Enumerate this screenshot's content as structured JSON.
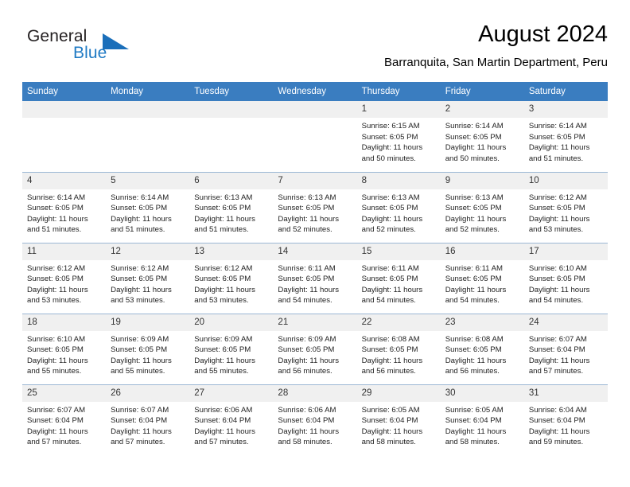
{
  "brand": {
    "name_primary": "General",
    "name_secondary": "Blue"
  },
  "header": {
    "title": "August 2024",
    "location": "Barranquita, San Martin Department, Peru"
  },
  "calendar": {
    "weekday_headers": [
      "Sunday",
      "Monday",
      "Tuesday",
      "Wednesday",
      "Thursday",
      "Friday",
      "Saturday"
    ],
    "colors": {
      "header_bg": "#3a7dc0",
      "daynum_bg": "#f0f0f0",
      "row_border": "#9bb7d4",
      "brand_blue": "#1f7ac4"
    },
    "weeks": [
      [
        {
          "day": "",
          "lines": []
        },
        {
          "day": "",
          "lines": []
        },
        {
          "day": "",
          "lines": []
        },
        {
          "day": "",
          "lines": []
        },
        {
          "day": "1",
          "lines": [
            "Sunrise: 6:15 AM",
            "Sunset: 6:05 PM",
            "Daylight: 11 hours",
            "and 50 minutes."
          ]
        },
        {
          "day": "2",
          "lines": [
            "Sunrise: 6:14 AM",
            "Sunset: 6:05 PM",
            "Daylight: 11 hours",
            "and 50 minutes."
          ]
        },
        {
          "day": "3",
          "lines": [
            "Sunrise: 6:14 AM",
            "Sunset: 6:05 PM",
            "Daylight: 11 hours",
            "and 51 minutes."
          ]
        }
      ],
      [
        {
          "day": "4",
          "lines": [
            "Sunrise: 6:14 AM",
            "Sunset: 6:05 PM",
            "Daylight: 11 hours",
            "and 51 minutes."
          ]
        },
        {
          "day": "5",
          "lines": [
            "Sunrise: 6:14 AM",
            "Sunset: 6:05 PM",
            "Daylight: 11 hours",
            "and 51 minutes."
          ]
        },
        {
          "day": "6",
          "lines": [
            "Sunrise: 6:13 AM",
            "Sunset: 6:05 PM",
            "Daylight: 11 hours",
            "and 51 minutes."
          ]
        },
        {
          "day": "7",
          "lines": [
            "Sunrise: 6:13 AM",
            "Sunset: 6:05 PM",
            "Daylight: 11 hours",
            "and 52 minutes."
          ]
        },
        {
          "day": "8",
          "lines": [
            "Sunrise: 6:13 AM",
            "Sunset: 6:05 PM",
            "Daylight: 11 hours",
            "and 52 minutes."
          ]
        },
        {
          "day": "9",
          "lines": [
            "Sunrise: 6:13 AM",
            "Sunset: 6:05 PM",
            "Daylight: 11 hours",
            "and 52 minutes."
          ]
        },
        {
          "day": "10",
          "lines": [
            "Sunrise: 6:12 AM",
            "Sunset: 6:05 PM",
            "Daylight: 11 hours",
            "and 53 minutes."
          ]
        }
      ],
      [
        {
          "day": "11",
          "lines": [
            "Sunrise: 6:12 AM",
            "Sunset: 6:05 PM",
            "Daylight: 11 hours",
            "and 53 minutes."
          ]
        },
        {
          "day": "12",
          "lines": [
            "Sunrise: 6:12 AM",
            "Sunset: 6:05 PM",
            "Daylight: 11 hours",
            "and 53 minutes."
          ]
        },
        {
          "day": "13",
          "lines": [
            "Sunrise: 6:12 AM",
            "Sunset: 6:05 PM",
            "Daylight: 11 hours",
            "and 53 minutes."
          ]
        },
        {
          "day": "14",
          "lines": [
            "Sunrise: 6:11 AM",
            "Sunset: 6:05 PM",
            "Daylight: 11 hours",
            "and 54 minutes."
          ]
        },
        {
          "day": "15",
          "lines": [
            "Sunrise: 6:11 AM",
            "Sunset: 6:05 PM",
            "Daylight: 11 hours",
            "and 54 minutes."
          ]
        },
        {
          "day": "16",
          "lines": [
            "Sunrise: 6:11 AM",
            "Sunset: 6:05 PM",
            "Daylight: 11 hours",
            "and 54 minutes."
          ]
        },
        {
          "day": "17",
          "lines": [
            "Sunrise: 6:10 AM",
            "Sunset: 6:05 PM",
            "Daylight: 11 hours",
            "and 54 minutes."
          ]
        }
      ],
      [
        {
          "day": "18",
          "lines": [
            "Sunrise: 6:10 AM",
            "Sunset: 6:05 PM",
            "Daylight: 11 hours",
            "and 55 minutes."
          ]
        },
        {
          "day": "19",
          "lines": [
            "Sunrise: 6:09 AM",
            "Sunset: 6:05 PM",
            "Daylight: 11 hours",
            "and 55 minutes."
          ]
        },
        {
          "day": "20",
          "lines": [
            "Sunrise: 6:09 AM",
            "Sunset: 6:05 PM",
            "Daylight: 11 hours",
            "and 55 minutes."
          ]
        },
        {
          "day": "21",
          "lines": [
            "Sunrise: 6:09 AM",
            "Sunset: 6:05 PM",
            "Daylight: 11 hours",
            "and 56 minutes."
          ]
        },
        {
          "day": "22",
          "lines": [
            "Sunrise: 6:08 AM",
            "Sunset: 6:05 PM",
            "Daylight: 11 hours",
            "and 56 minutes."
          ]
        },
        {
          "day": "23",
          "lines": [
            "Sunrise: 6:08 AM",
            "Sunset: 6:05 PM",
            "Daylight: 11 hours",
            "and 56 minutes."
          ]
        },
        {
          "day": "24",
          "lines": [
            "Sunrise: 6:07 AM",
            "Sunset: 6:04 PM",
            "Daylight: 11 hours",
            "and 57 minutes."
          ]
        }
      ],
      [
        {
          "day": "25",
          "lines": [
            "Sunrise: 6:07 AM",
            "Sunset: 6:04 PM",
            "Daylight: 11 hours",
            "and 57 minutes."
          ]
        },
        {
          "day": "26",
          "lines": [
            "Sunrise: 6:07 AM",
            "Sunset: 6:04 PM",
            "Daylight: 11 hours",
            "and 57 minutes."
          ]
        },
        {
          "day": "27",
          "lines": [
            "Sunrise: 6:06 AM",
            "Sunset: 6:04 PM",
            "Daylight: 11 hours",
            "and 57 minutes."
          ]
        },
        {
          "day": "28",
          "lines": [
            "Sunrise: 6:06 AM",
            "Sunset: 6:04 PM",
            "Daylight: 11 hours",
            "and 58 minutes."
          ]
        },
        {
          "day": "29",
          "lines": [
            "Sunrise: 6:05 AM",
            "Sunset: 6:04 PM",
            "Daylight: 11 hours",
            "and 58 minutes."
          ]
        },
        {
          "day": "30",
          "lines": [
            "Sunrise: 6:05 AM",
            "Sunset: 6:04 PM",
            "Daylight: 11 hours",
            "and 58 minutes."
          ]
        },
        {
          "day": "31",
          "lines": [
            "Sunrise: 6:04 AM",
            "Sunset: 6:04 PM",
            "Daylight: 11 hours",
            "and 59 minutes."
          ]
        }
      ]
    ]
  }
}
